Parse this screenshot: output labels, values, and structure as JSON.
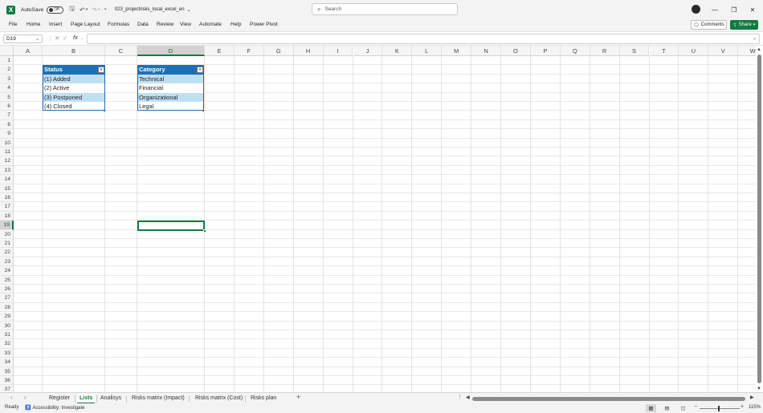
{
  "titlebar": {
    "autosave_label": "AutoSave",
    "autosave_state": "Off",
    "filename": "023_projectrisks_local_excel_en",
    "search_placeholder": "Search"
  },
  "menu": [
    "File",
    "Home",
    "Insert",
    "Page Layout",
    "Formulas",
    "Data",
    "Review",
    "View",
    "Automate",
    "Help",
    "Power Pivot"
  ],
  "menu_actions": {
    "comments": "Comments",
    "share": "Share"
  },
  "formula_bar": {
    "name_box": "D19",
    "formula": ""
  },
  "columns": [
    "A",
    "B",
    "C",
    "D",
    "E",
    "F",
    "G",
    "H",
    "I",
    "J",
    "K",
    "L",
    "M",
    "N",
    "O",
    "P",
    "Q",
    "R",
    "S",
    "T",
    "U",
    "V",
    "W"
  ],
  "selected_column": "D",
  "selected_row": 19,
  "rows": [
    1,
    2,
    3,
    4,
    5,
    6,
    7,
    8,
    9,
    10,
    11,
    12,
    13,
    14,
    15,
    16,
    17,
    18,
    19,
    20,
    21,
    22,
    23,
    24,
    25,
    26,
    27,
    28,
    29,
    30,
    31,
    32,
    33,
    34,
    35,
    36,
    37
  ],
  "tables": {
    "status": {
      "header": "Status",
      "items": [
        "(1) Added",
        "(2) Active",
        "(3) Postponed",
        "(4) Closed"
      ]
    },
    "category": {
      "header": "Category",
      "items": [
        "Technical",
        "Financial",
        "Organizational",
        "Legal"
      ]
    }
  },
  "sheets": [
    "Register",
    "Lists",
    "Analisys",
    "Risks matrix (Impact)",
    "Risks matrix (Cost)",
    "Risks plan"
  ],
  "active_sheet": "Lists",
  "status_bar": {
    "status": "Ready",
    "accessibility": "Accessibility: Investigate",
    "zoom": "115%"
  },
  "colors": {
    "accent": "#107c41",
    "table_header": "#1f6fb5",
    "table_band": "#bfe0f3"
  }
}
